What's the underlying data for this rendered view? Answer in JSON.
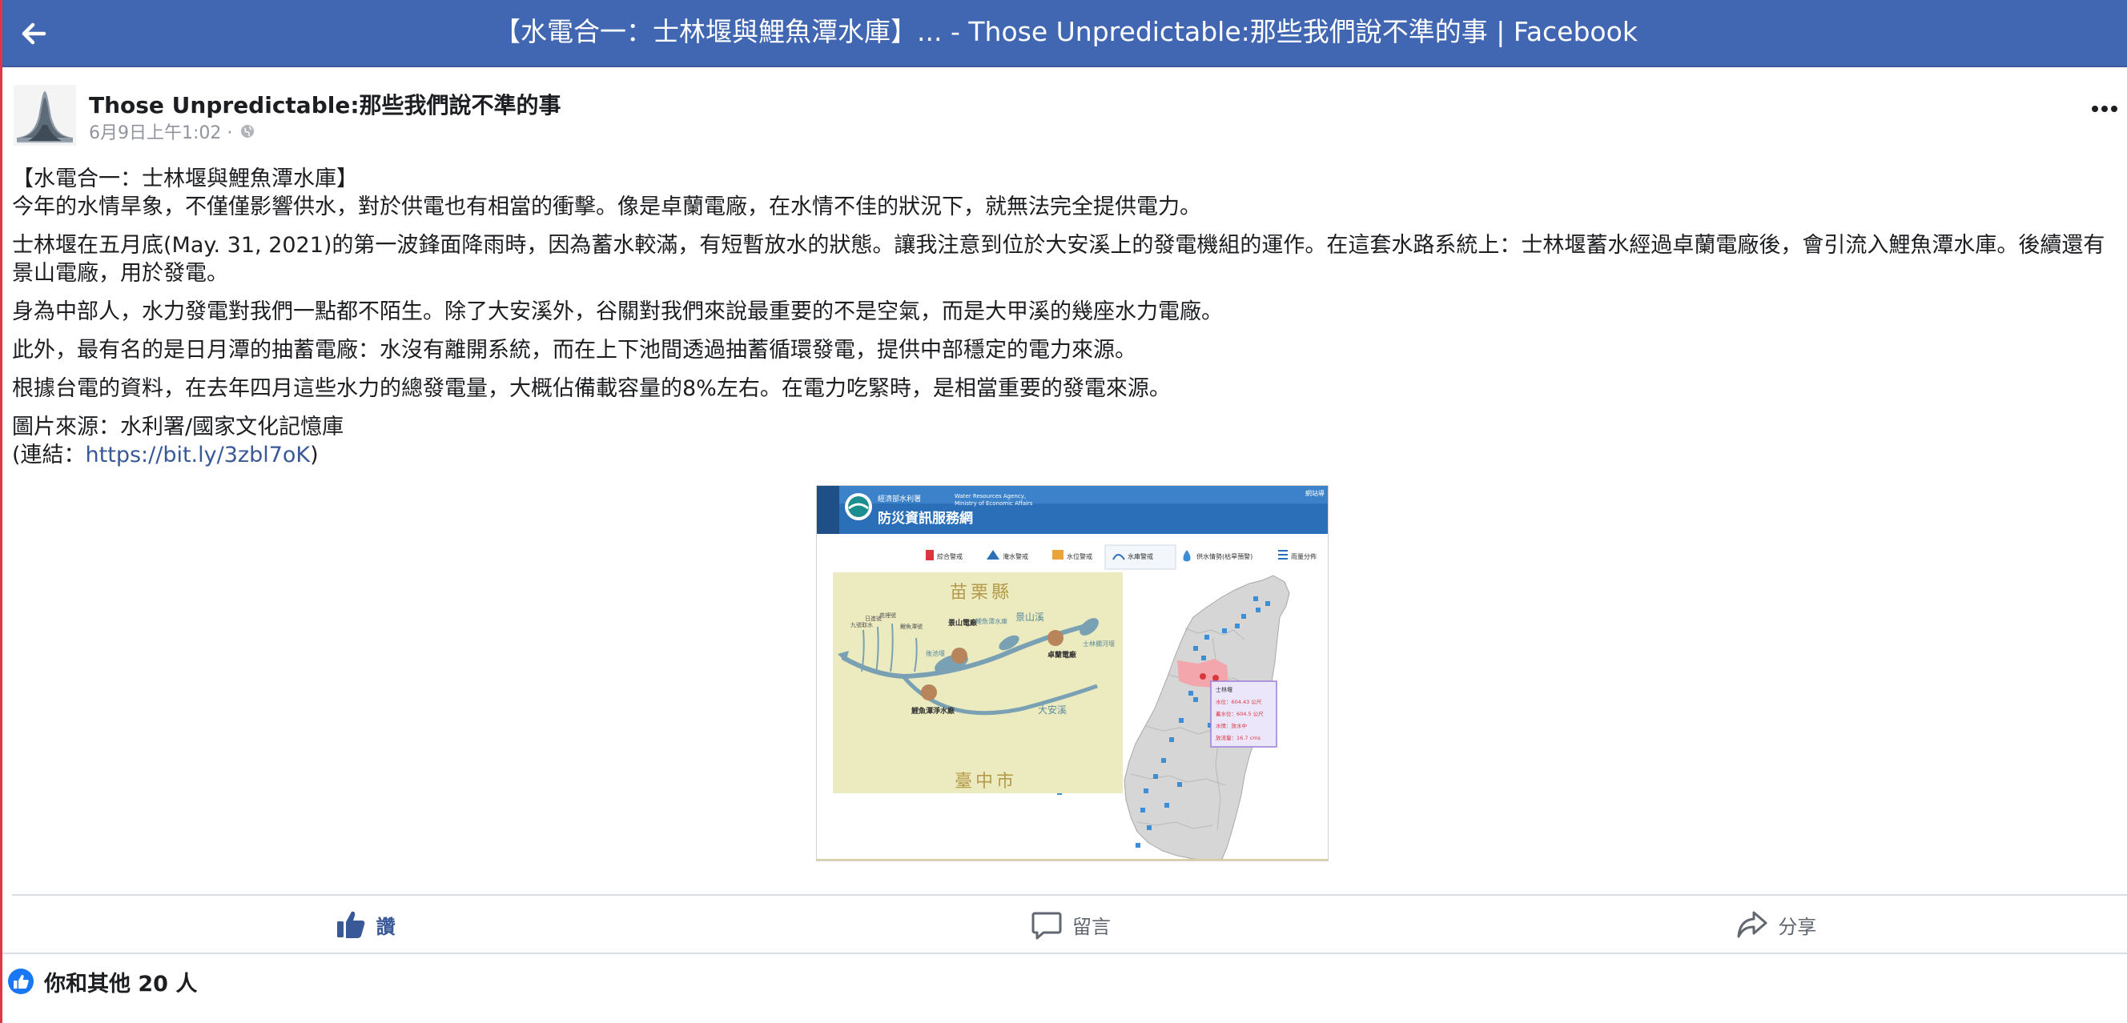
{
  "topbar": {
    "title": "【水電合一：士林堰與鯉魚潭水庫】... - Those Unpredictable:那些我們說不準的事 | Facebook"
  },
  "post": {
    "author": "Those Unpredictable:那些我們說不準的事",
    "timestamp": "6月9日上午1:02 · ",
    "paragraphs": {
      "p1_line1": "【水電合一：士林堰與鯉魚潭水庫】",
      "p1_line2": "今年的水情旱象，不僅僅影響供水，對於供電也有相當的衝擊。像是卓蘭電廠，在水情不佳的狀況下，就無法完全提供電力。",
      "p2": "士林堰在五月底(May. 31, 2021)的第一波鋒面降雨時，因為蓄水較滿，有短暫放水的狀態。讓我注意到位於大安溪上的發電機組的運作。在這套水路系統上：士林堰蓄水經過卓蘭電廠後，會引流入鯉魚潭水庫。後續還有景山電廠，用於發電。",
      "p3": "身為中部人，水力發電對我們一點都不陌生。除了大安溪外，谷關對我們來說最重要的不是空氣，而是大甲溪的幾座水力電廠。",
      "p4": "此外，最有名的是日月潭的抽蓄電廠：水沒有離開系統，而在上下池間透過抽蓄循環發電，提供中部穩定的電力來源。",
      "p5": "根據台電的資料，在去年四月這些水力的總發電量，大概佔備載容量的8%左右。在電力吃緊時，是相當重要的發電來源。",
      "p6_line1": "圖片來源：水利署/國家文化記憶庫",
      "p6_prefix": "(連結：",
      "p6_link": "https://bit.ly/3zbl7oK",
      "p6_suffix": ")"
    }
  },
  "image": {
    "agency_small": "經濟部水利署",
    "agency_en1": "Water Resources Agency,",
    "agency_en2": "Ministry of Economic Affairs",
    "site_title": "防災資訊服務網",
    "corner_link": "網站導",
    "tabs": [
      "綜合警戒",
      "淹水警戒",
      "水位警戒",
      "水庫警戒",
      "供水情勢(枯旱預警)",
      "雨量分佈"
    ],
    "county_top": "苗栗縣",
    "county_bottom": "臺中市",
    "labels": {
      "jingshan_plant": "景山電廠",
      "liyutan_reservoir": "鯉魚潭水庫",
      "jingshan_creek": "景山溪",
      "zhuolan_plant": "卓蘭電廠",
      "shilin_weir": "士林攔河堰",
      "houchi_weir": "後池堰",
      "daan_river": "大安溪",
      "liyutan_water_plant": "鯉魚潭淨水廠",
      "ch1": "九號取水",
      "ch2": "日進號",
      "ch3": "苑裡號",
      "ch4": "鯉魚潭號"
    },
    "popup": {
      "title": "士林堰",
      "rows": [
        "水位：604.43 公尺",
        "蓄水位：604.5 公尺",
        "水情：放水中",
        "放流量：16.7 cms"
      ]
    },
    "colors": {
      "header_blue": "#2a6fb8",
      "inset_bg": "#ecebc0",
      "river": "#7aa0b3",
      "plant": "#b8845a",
      "highlight_red": "#f3a7ad",
      "popup_border": "#9b7fd6"
    }
  },
  "actions": {
    "like": "讚",
    "comment": "留言",
    "share": "分享"
  },
  "reactions": {
    "summary": "你和其他 20 人"
  },
  "colors": {
    "facebook_blue": "#4267b2",
    "link": "#385898",
    "meta_gray": "#90949c"
  }
}
